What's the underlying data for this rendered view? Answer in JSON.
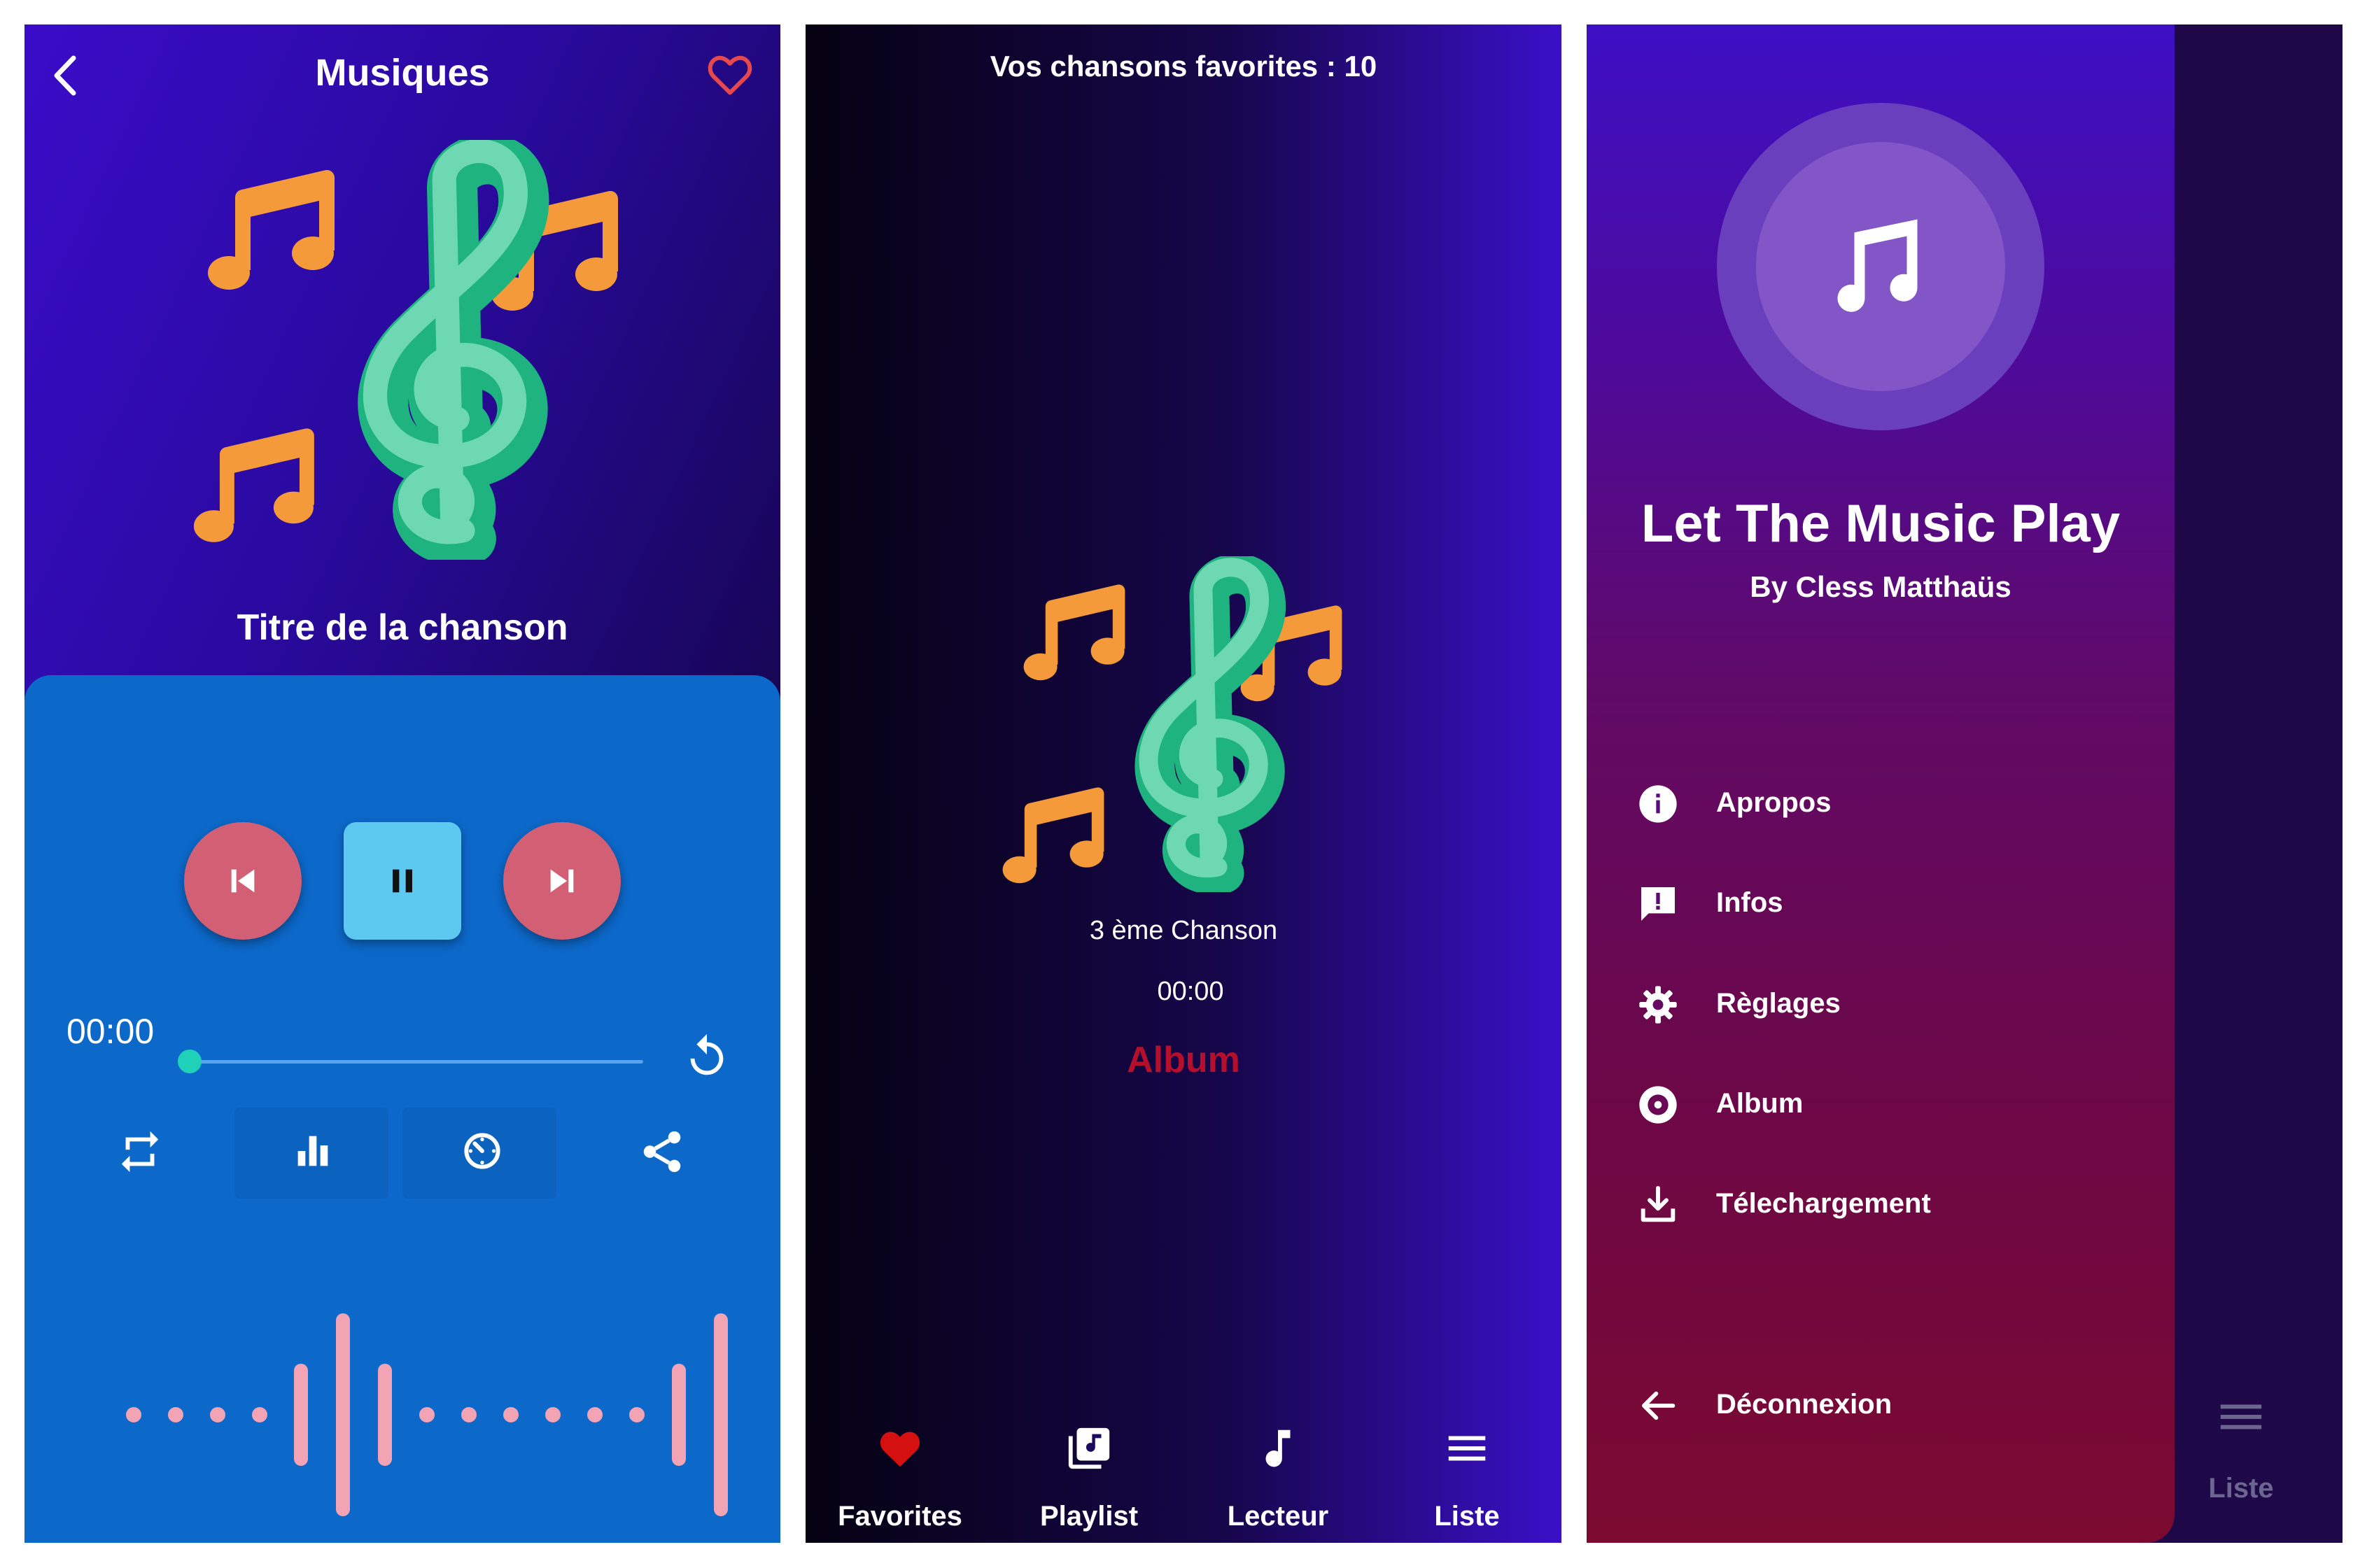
{
  "panel1": {
    "title": "Musiques",
    "song_title": "Titre de la chanson",
    "current_time": "00:00",
    "progress": 0,
    "colors": {
      "accent": "#1fd1b8",
      "card": "#0c68c9",
      "round_button": "#d25f73",
      "play_button": "#5ec9f0",
      "heart": "#e5484d"
    },
    "icons": [
      "back-arrow-icon",
      "heart-outline-icon",
      "skip-previous-icon",
      "pause-icon",
      "skip-next-icon",
      "replay-icon",
      "repeat-icon",
      "equalizer-icon",
      "timer-icon",
      "share-icon"
    ]
  },
  "panel2": {
    "header": "Vos chansons favorites : 10",
    "song": "3 ème Chanson",
    "time": "00:00",
    "album": "Album",
    "nav": [
      {
        "label": "Favorites",
        "icon": "heart-icon"
      },
      {
        "label": "Playlist",
        "icon": "playlist-icon"
      },
      {
        "label": "Lecteur",
        "icon": "music-note-icon"
      },
      {
        "label": "Liste",
        "icon": "menu-icon"
      }
    ]
  },
  "panel3": {
    "title": "Let The Music Play",
    "subtitle": "By Cless Matthaüs",
    "menu": [
      {
        "label": "Apropos",
        "icon": "info-icon"
      },
      {
        "label": "Infos",
        "icon": "feedback-icon"
      },
      {
        "label": "Règlages",
        "icon": "settings-icon"
      },
      {
        "label": "Album",
        "icon": "album-icon"
      },
      {
        "label": "Télechargement",
        "icon": "download-icon"
      }
    ],
    "logout": "Déconnexion",
    "nav_label": "Liste"
  }
}
